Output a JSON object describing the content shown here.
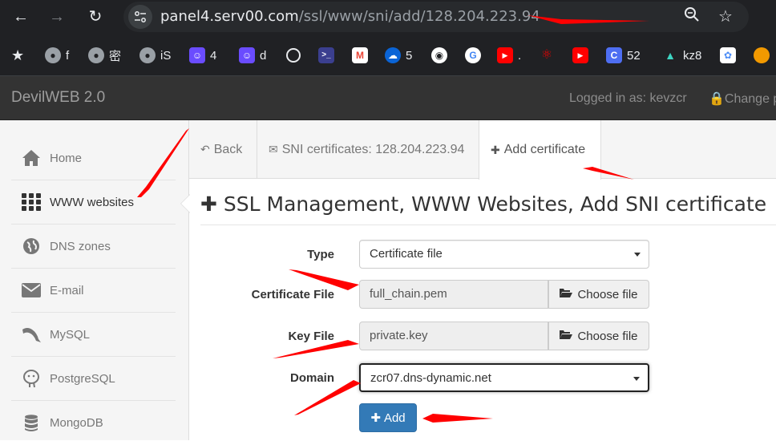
{
  "browser": {
    "url_host": "panel4.serv00.com",
    "url_path": "/ssl/www/sni/add/128.204.223.94",
    "bookmarks": [
      {
        "label": "f",
        "icon": "globe-icon",
        "color": "#5f6368"
      },
      {
        "label": "密",
        "icon": "globe-icon",
        "color": "#5f6368"
      },
      {
        "label": "iS",
        "icon": "globe-icon",
        "color": "#5f6368"
      },
      {
        "label": "4",
        "icon": "ghost-icon",
        "color": "#6a4cff"
      },
      {
        "label": "d",
        "icon": "ghost-icon",
        "color": "#6a4cff"
      },
      {
        "label": "",
        "icon": "openai-icon",
        "color": "#202124"
      },
      {
        "label": "",
        "icon": "terminal-icon",
        "color": "#3b3f8f"
      },
      {
        "label": "",
        "icon": "gmail-icon",
        "color": "#ea4335"
      },
      {
        "label": "5",
        "icon": "onedrive-icon",
        "color": "#0a64d6"
      },
      {
        "label": "",
        "icon": "github-icon",
        "color": "#ffffff"
      },
      {
        "label": "",
        "icon": "google-icon",
        "color": "#ffffff"
      },
      {
        "label": ".",
        "icon": "youtube-icon",
        "color": "#ff0000"
      },
      {
        "label": "",
        "icon": "red-logo-icon",
        "color": "#e00"
      },
      {
        "label": "",
        "icon": "youtube-icon",
        "color": "#ff0000"
      },
      {
        "label": "52",
        "icon": "c-app-icon",
        "color": "#4e6ef2"
      },
      {
        "label": "kz8",
        "icon": "mountain-icon",
        "color": "#3dd6c3"
      },
      {
        "label": "",
        "icon": "cloud-app-icon",
        "color": "#4e8ef7"
      },
      {
        "label": "",
        "icon": "orange-circle-icon",
        "color": "#f29900"
      }
    ]
  },
  "header": {
    "brand": "DevilWEB 2.0",
    "logged_in": "Logged in as: kevzcr",
    "change_password": "Change pa"
  },
  "sidebar": {
    "items": [
      {
        "label": "Home",
        "icon": "home-icon"
      },
      {
        "label": "WWW websites",
        "icon": "grid-icon"
      },
      {
        "label": "DNS zones",
        "icon": "globe-icon"
      },
      {
        "label": "E-mail",
        "icon": "envelope-icon"
      },
      {
        "label": "MySQL",
        "icon": "dolphin-icon"
      },
      {
        "label": "PostgreSQL",
        "icon": "elephant-icon"
      },
      {
        "label": "MongoDB",
        "icon": "database-icon"
      }
    ]
  },
  "tabs": {
    "back": "Back",
    "sni": "SNI certificates: 128.204.223.94",
    "add": "Add certificate"
  },
  "page": {
    "title": "SSL Management, WWW Websites, Add SNI certificate"
  },
  "form": {
    "type_label": "Type",
    "type_value": "Certificate file",
    "cert_label": "Certificate File",
    "cert_value": "full_chain.pem",
    "key_label": "Key File",
    "key_value": "private.key",
    "choose_label": "Choose file",
    "domain_label": "Domain",
    "domain_value": "zcr07.dns-dynamic.net",
    "add_label": "Add"
  },
  "colors": {
    "chrome_bg": "#202124",
    "header_bg": "#333333",
    "primary": "#337ab7",
    "annotation_red": "#ff0000"
  }
}
